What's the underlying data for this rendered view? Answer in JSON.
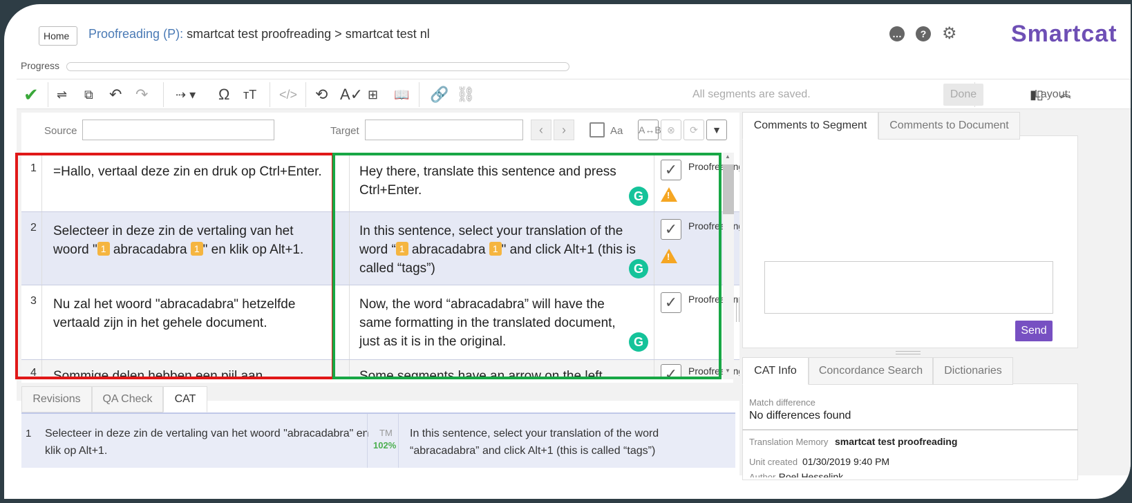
{
  "header": {
    "home_label": "Home",
    "breadcrumb_link": "Proofreading (P):",
    "breadcrumb_rest": " smartcat test proofreading > smartcat test nl",
    "logo": "Smartcat",
    "progress_label": "Progress",
    "progress_value": 0,
    "icons": [
      "chat-icon",
      "help-icon",
      "gear-icon"
    ]
  },
  "toolbar": {
    "saved_status": "All segments are saved.",
    "done_label": "Done",
    "layout_label": "Layout:"
  },
  "filters": {
    "source_label": "Source",
    "target_label": "Target",
    "case_label": "Aa"
  },
  "segments": [
    {
      "num": "1",
      "source": "=Hallo, vertaal deze zin en druk op Ctrl+Enter.",
      "target": "Hey there, translate this sentence and press Ctrl+Enter.",
      "status": "Proofreading"
    },
    {
      "num": "2",
      "source_before": "Selecteer in deze zin de vertaling van het woord \"",
      "source_word": " abracadabra ",
      "source_after": "\" en klik op Alt+1.",
      "target_before": "In this sentence, select your translation of the word “",
      "target_word": " abracadabra ",
      "target_after": "\" and click Alt+1 (this is called “tags”)",
      "tag_label": "1",
      "status": "Proofreading"
    },
    {
      "num": "3",
      "source": "Nu zal het woord \"abracadabra\" hetzelfde vertaald zijn in het gehele document.",
      "target": "Now, the word “abracadabra” will have the same formatting in the translated document, just as it is in the original.",
      "status": "Proofreading"
    },
    {
      "num": "4",
      "source": "Sommige delen hebben een pijl aan",
      "target": "Some segments have an arrow on the left",
      "status": "Proofreading"
    }
  ],
  "bottom_tabs": [
    "Revisions",
    "QA Check",
    "CAT"
  ],
  "cat_match": {
    "num": "1",
    "source": "Selecteer in deze zin de vertaling van het woord \"abracadabra\" en klik op Alt+1.",
    "tm_label": "TM",
    "percent": "102%",
    "target": "In this sentence, select your translation of the word “abracadabra” and click Alt+1 (this is called “tags”)"
  },
  "comments": {
    "tabs": [
      "Comments to Segment",
      "Comments to Document"
    ],
    "send_label": "Send"
  },
  "cat_info": {
    "tabs": [
      "CAT Info",
      "Concordance Search",
      "Dictionaries"
    ],
    "match_diff_label": "Match difference",
    "match_diff_value": "No differences found",
    "tm_label": "Translation Memory",
    "tm_value": "smartcat test proofreading",
    "unit_label": "Unit created",
    "unit_value": "01/30/2019 9:40 PM",
    "author_label": "Author",
    "author_value": "Roel Hesselink"
  }
}
